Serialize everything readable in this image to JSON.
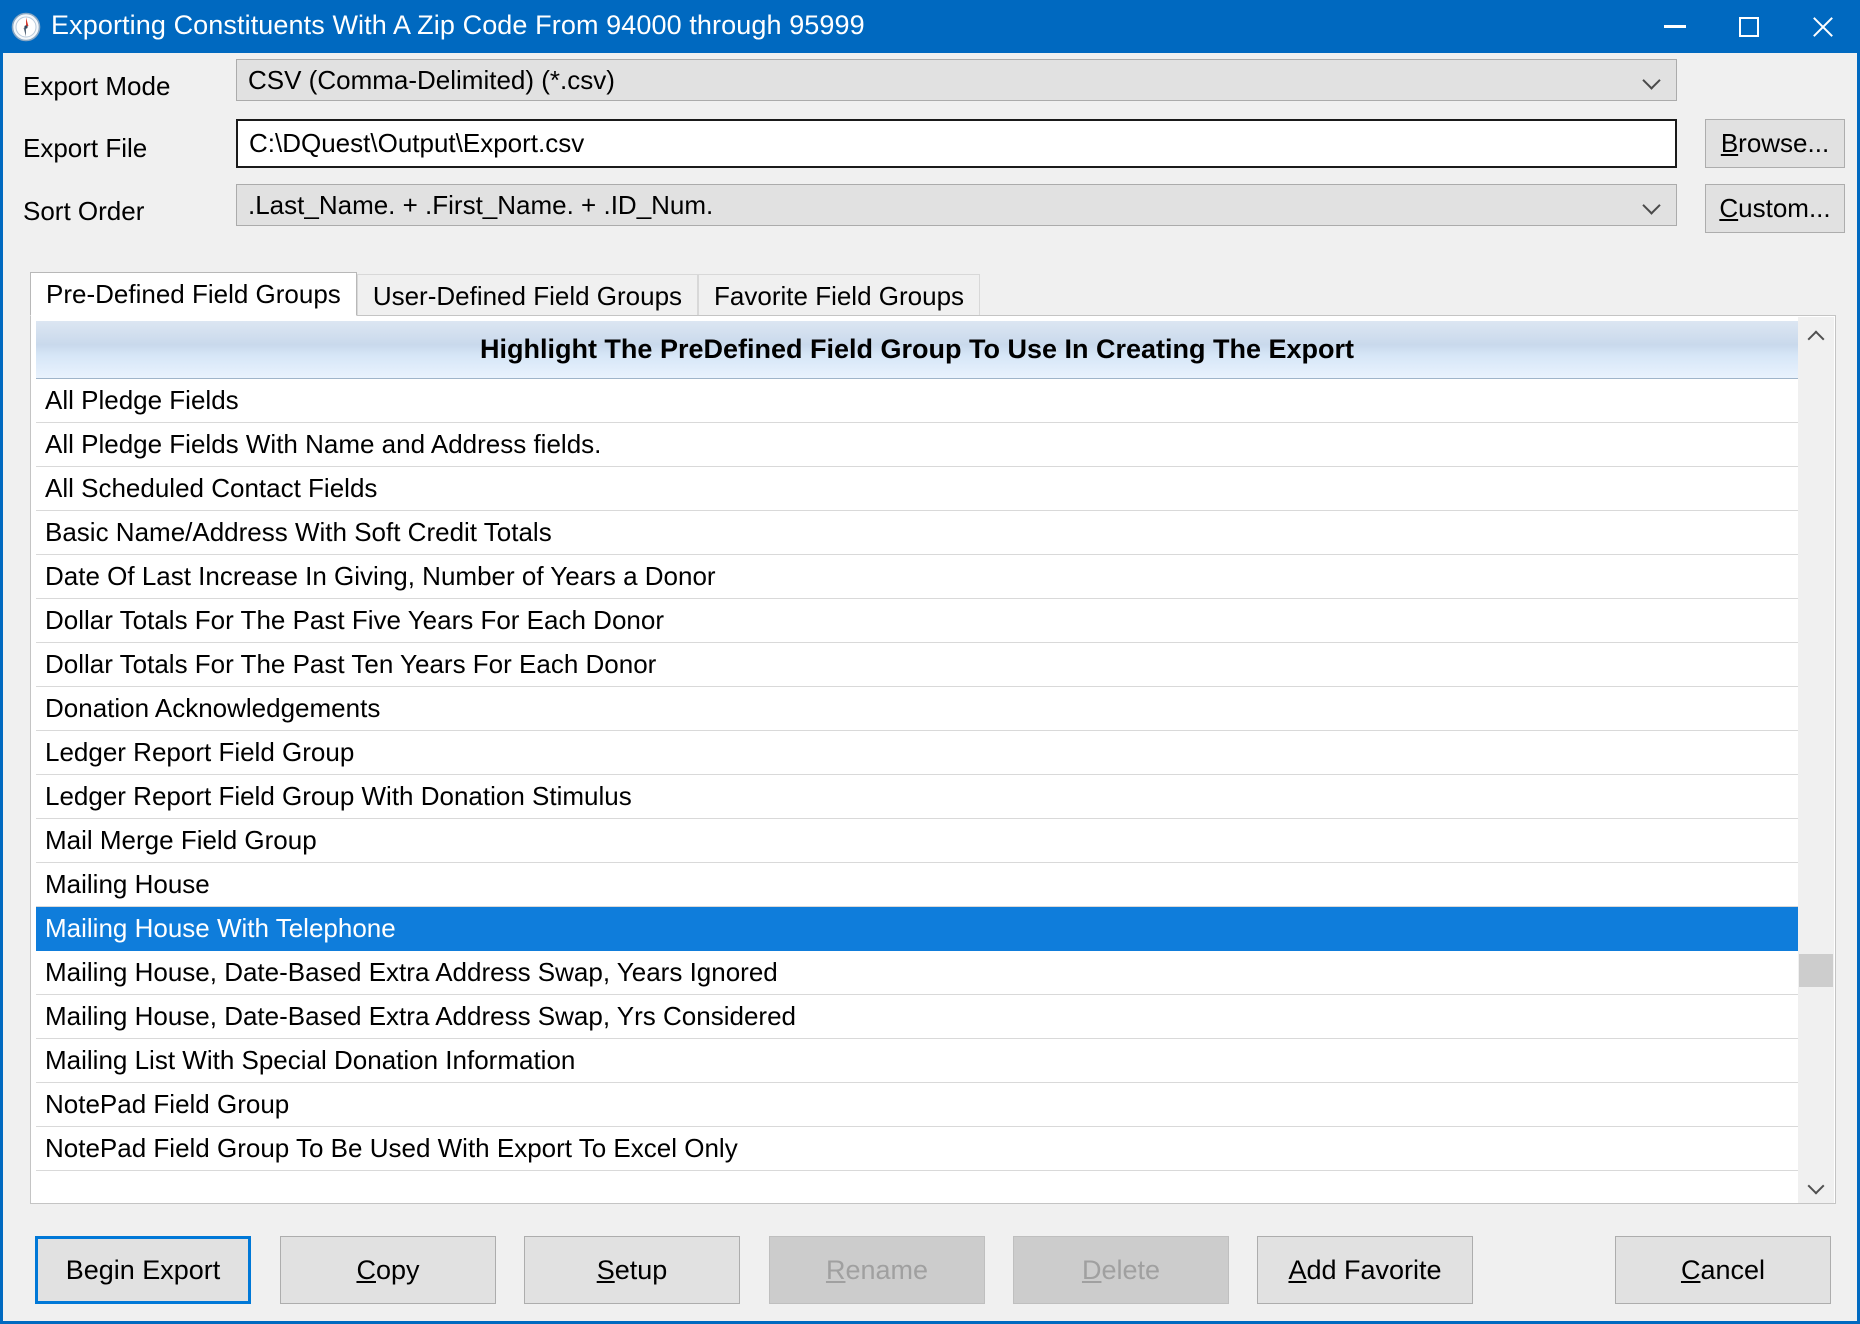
{
  "window": {
    "title": "Exporting Constituents With A Zip Code From 94000 through 95999",
    "icon": "compass-icon",
    "accent_color": "#0069c0",
    "minimize_label": "Minimize",
    "maximize_label": "Maximize",
    "close_label": "Close"
  },
  "form": {
    "export_mode": {
      "label": "Export Mode",
      "value": "CSV (Comma-Delimited) (*.csv)"
    },
    "export_file": {
      "label": "Export File",
      "value": "C:\\DQuest\\Output\\Export.csv",
      "placeholder": ""
    },
    "sort_order": {
      "label": "Sort Order",
      "value": ".Last_Name. + .First_Name. + .ID_Num."
    },
    "browse_button": {
      "pre": "",
      "accel": "B",
      "post": "rowse..."
    },
    "custom_button": {
      "pre": "",
      "accel": "C",
      "post": "ustom..."
    }
  },
  "tabs": [
    {
      "label": "Pre-Defined Field Groups",
      "active": true
    },
    {
      "label": "User-Defined Field Groups",
      "active": false
    },
    {
      "label": "Favorite Field Groups",
      "active": false
    }
  ],
  "list": {
    "header": "Highlight The PreDefined Field Group To Use In Creating The Export",
    "selected_index": 12,
    "items": [
      "All Pledge Fields",
      "All Pledge Fields With Name and Address fields.",
      "All Scheduled Contact Fields",
      "Basic Name/Address With Soft Credit Totals",
      "Date Of Last Increase In Giving, Number of Years a Donor",
      "Dollar Totals For The Past Five Years For Each Donor",
      "Dollar Totals For The Past Ten Years For Each Donor",
      "Donation Acknowledgements",
      "Ledger Report Field Group",
      "Ledger Report Field Group With Donation Stimulus",
      "Mail Merge Field Group",
      "Mailing House",
      "Mailing House With Telephone",
      "Mailing House, Date-Based Extra Address Swap, Years Ignored",
      "Mailing House, Date-Based Extra Address Swap, Yrs Considered",
      "Mailing List With Special Donation Information",
      "NotePad Field Group",
      "NotePad Field Group To Be Used With Export To Excel Only"
    ],
    "selected_item": "Mailing House",
    "scrollbar": {
      "up_arrow": "chevron-up-icon",
      "down_arrow": "chevron-down-icon"
    }
  },
  "buttons": {
    "begin_export": {
      "pre": "Begin Export",
      "accel": "",
      "post": "",
      "state": "default"
    },
    "copy": {
      "pre": "",
      "accel": "C",
      "post": "opy",
      "state": "enabled"
    },
    "setup": {
      "pre": "",
      "accel": "S",
      "post": "etup",
      "state": "enabled"
    },
    "rename": {
      "pre": "",
      "accel": "R",
      "post": "ename",
      "state": "disabled"
    },
    "delete": {
      "pre": "",
      "accel": "D",
      "post": "elete",
      "state": "disabled"
    },
    "add_favorite": {
      "pre": "",
      "accel": "A",
      "post": "dd Favorite",
      "state": "enabled"
    },
    "cancel": {
      "pre": "",
      "accel": "C",
      "post": "ancel",
      "state": "enabled"
    }
  }
}
